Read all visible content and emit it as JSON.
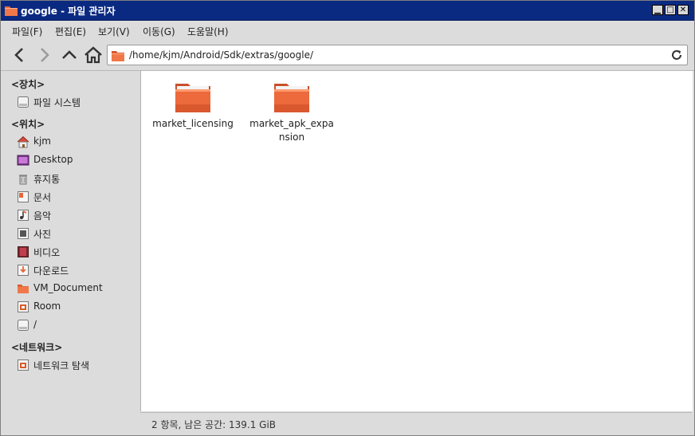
{
  "window": {
    "title": "google - 파일 관리자",
    "minimize": "▁",
    "maximize": "□",
    "close": "✕"
  },
  "menu": [
    "파일(F)",
    "편집(E)",
    "보기(V)",
    "이동(G)",
    "도움말(H)"
  ],
  "location": {
    "path": "/home/kjm/Android/Sdk/extras/google/"
  },
  "sidebar": {
    "devices_header": "<장치>",
    "devices": [
      {
        "label": "파일 시스템",
        "icon": "drive-icon"
      }
    ],
    "places_header": "<위치>",
    "places": [
      {
        "label": "kjm",
        "icon": "home-icon"
      },
      {
        "label": "Desktop",
        "icon": "desktop-icon"
      },
      {
        "label": "휴지통",
        "icon": "trash-icon"
      },
      {
        "label": "문서",
        "icon": "documents-icon"
      },
      {
        "label": "음악",
        "icon": "music-icon"
      },
      {
        "label": "사진",
        "icon": "pictures-icon"
      },
      {
        "label": "비디오",
        "icon": "video-icon"
      },
      {
        "label": "다운로드",
        "icon": "download-icon"
      },
      {
        "label": "VM_Document",
        "icon": "folder-icon"
      },
      {
        "label": "Room",
        "icon": "folder-special-icon"
      },
      {
        "label": "/",
        "icon": "drive-icon"
      }
    ],
    "network_header": "<네트워크>",
    "network": [
      {
        "label": "네트워크 탐색",
        "icon": "network-icon"
      }
    ]
  },
  "files": [
    {
      "name": "market_licensing",
      "icon": "folder-icon"
    },
    {
      "name": "market_apk_expansion",
      "icon": "folder-icon"
    }
  ],
  "status": {
    "text": "2 항목, 남은 공간: 139.1 GiB"
  },
  "colors": {
    "titlebar": "#0a2a82",
    "folder": "#e8663a",
    "sidebar": "#dcdcdc"
  }
}
